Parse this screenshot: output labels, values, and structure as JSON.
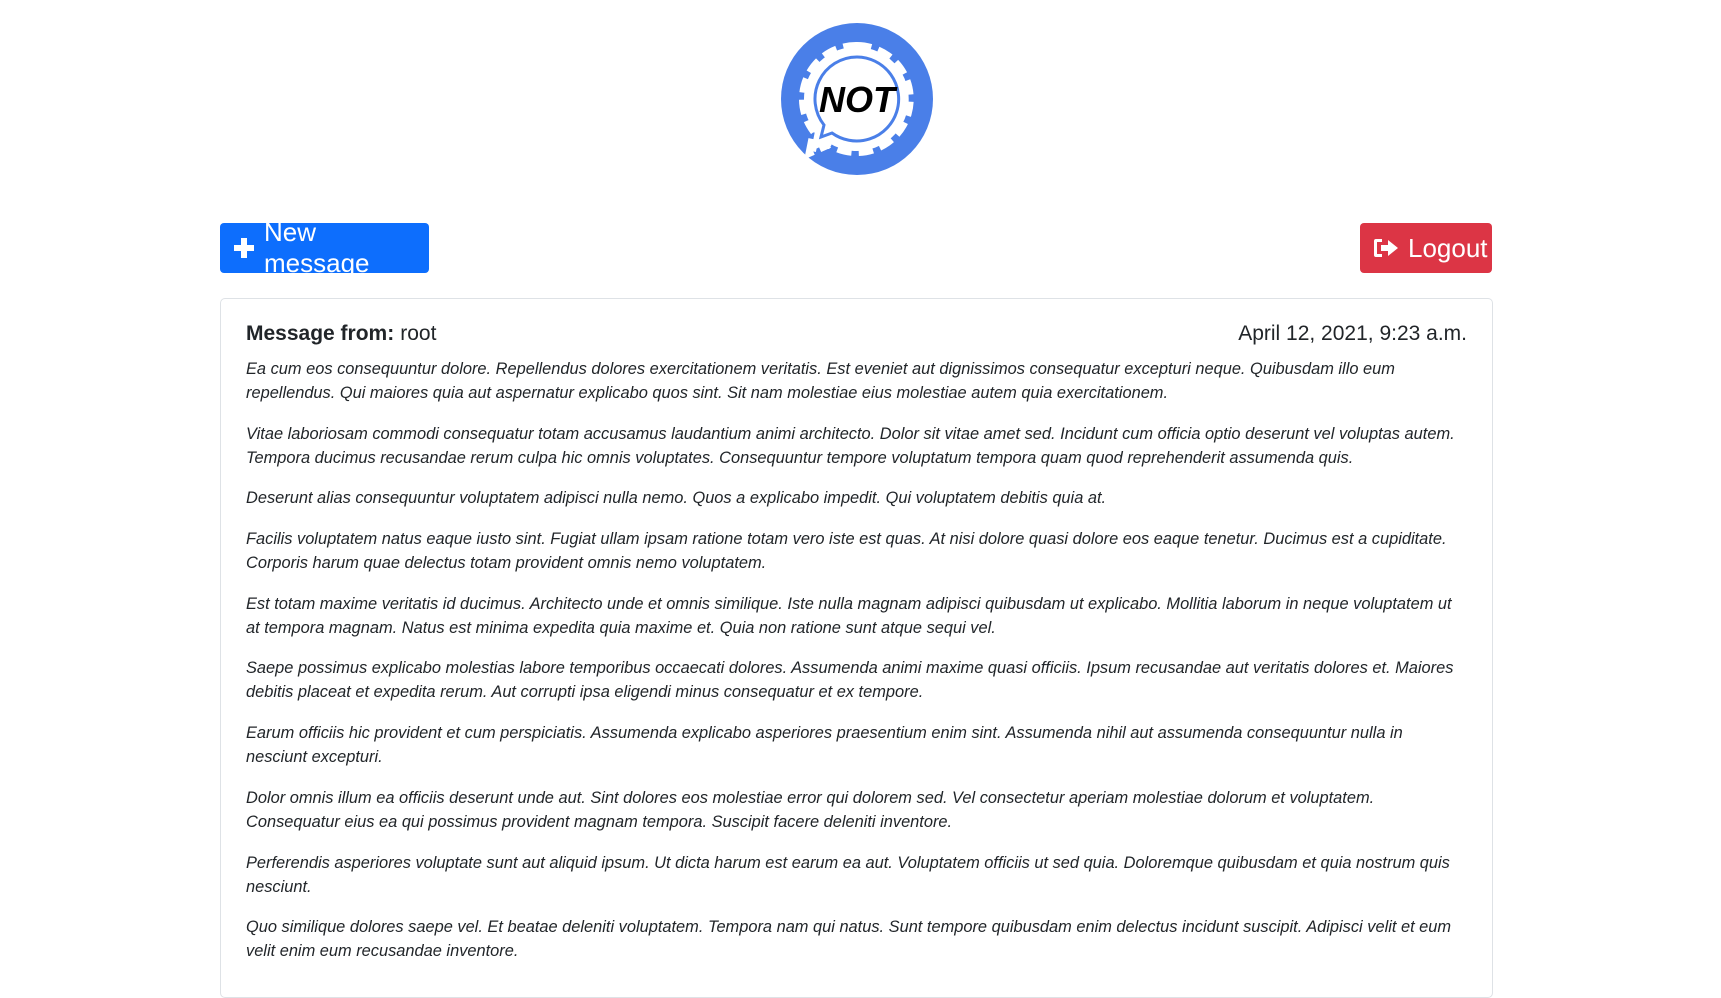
{
  "logo": {
    "text": "NOT",
    "color": "#4a7fe8"
  },
  "toolbar": {
    "new_message_label": "New message",
    "new_message_icon": "plus-icon",
    "logout_label": "Logout",
    "logout_icon": "sign-out-icon",
    "new_message_color": "#0d6efd",
    "logout_color": "#dc3545"
  },
  "message": {
    "from_label": "Message from:",
    "from_value": "root",
    "date": "April 12, 2021, 9:23 a.m.",
    "paragraphs": [
      "Ea cum eos consequuntur dolore. Repellendus dolores exercitationem veritatis. Est eveniet aut dignissimos consequatur excepturi neque. Quibusdam illo eum repellendus. Qui maiores quia aut aspernatur explicabo quos sint. Sit nam molestiae eius molestiae autem quia exercitationem.",
      "Vitae laboriosam commodi consequatur totam accusamus laudantium animi architecto. Dolor sit vitae amet sed. Incidunt cum officia optio deserunt vel voluptas autem. Tempora ducimus recusandae rerum culpa hic omnis voluptates. Consequuntur tempore voluptatum tempora quam quod reprehenderit assumenda quis.",
      "Deserunt alias consequuntur voluptatem adipisci nulla nemo. Quos a explicabo impedit. Qui voluptatem debitis quia at.",
      "Facilis voluptatem natus eaque iusto sint. Fugiat ullam ipsam ratione totam vero iste est quas. At nisi dolore quasi dolore eos eaque tenetur. Ducimus est a cupiditate. Corporis harum quae delectus totam provident omnis nemo voluptatem.",
      "Est totam maxime veritatis id ducimus. Architecto unde et omnis similique. Iste nulla magnam adipisci quibusdam ut explicabo. Mollitia laborum in neque voluptatem ut at tempora magnam. Natus est minima expedita quia maxime et. Quia non ratione sunt atque sequi vel.",
      "Saepe possimus explicabo molestias labore temporibus occaecati dolores. Assumenda animi maxime quasi officiis. Ipsum recusandae aut veritatis dolores et. Maiores debitis placeat et expedita rerum. Aut corrupti ipsa eligendi minus consequatur et ex tempore.",
      "Earum officiis hic provident et cum perspiciatis. Assumenda explicabo asperiores praesentium enim sint. Assumenda nihil aut assumenda consequuntur nulla in nesciunt excepturi.",
      "Dolor omnis illum ea officiis deserunt unde aut. Sint dolores eos molestiae error qui dolorem sed. Vel consectetur aperiam molestiae dolorum et voluptatem. Consequatur eius ea qui possimus provident magnam tempora. Suscipit facere deleniti inventore.",
      "Perferendis asperiores voluptate sunt aut aliquid ipsum. Ut dicta harum est earum ea aut. Voluptatem officiis ut sed quia. Doloremque quibusdam et quia nostrum quis nesciunt.",
      "Quo similique dolores saepe vel. Et beatae deleniti voluptatem. Tempora nam qui natus. Sunt tempore quibusdam enim delectus incidunt suscipit. Adipisci velit et eum velit enim eum recusandae inventore."
    ]
  }
}
